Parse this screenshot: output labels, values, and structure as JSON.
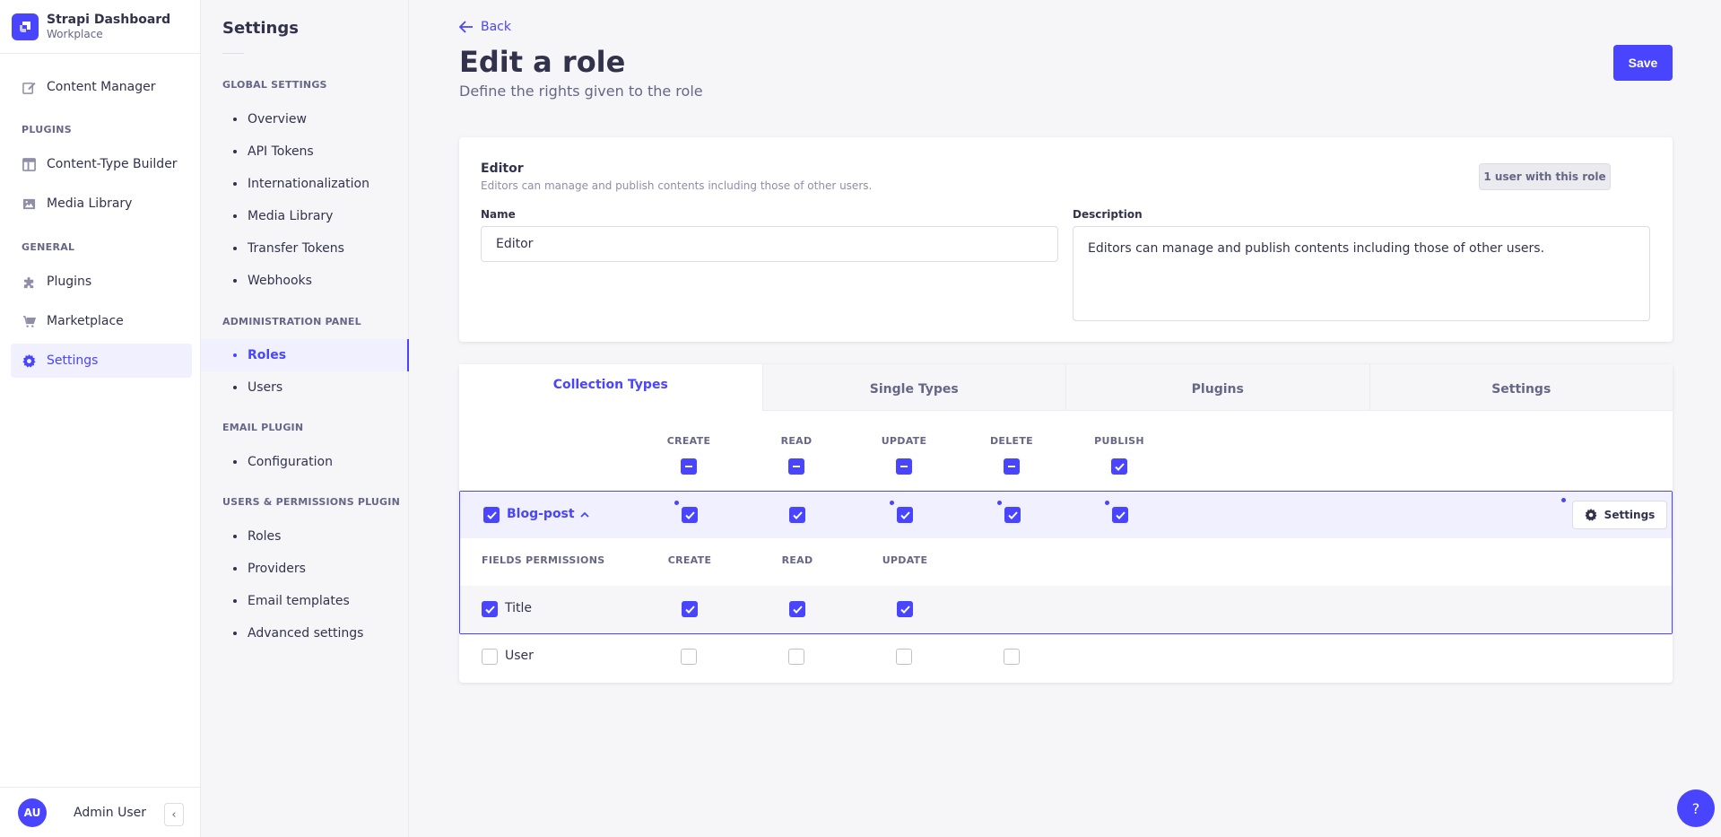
{
  "brand": {
    "title": "Strapi Dashboard",
    "subtitle": "Workplace"
  },
  "mainnav": {
    "content_manager": "Content Manager",
    "plugins_section": "PLUGINS",
    "content_type_builder": "Content-Type Builder",
    "media_library": "Media Library",
    "general_section": "GENERAL",
    "plugins": "Plugins",
    "marketplace": "Marketplace",
    "settings": "Settings"
  },
  "profile": {
    "initials": "AU",
    "name": "Admin User"
  },
  "subnav": {
    "title": "Settings",
    "global_section": "GLOBAL SETTINGS",
    "global_items": [
      "Overview",
      "API Tokens",
      "Internationalization",
      "Media Library",
      "Transfer Tokens",
      "Webhooks"
    ],
    "admin_section": "ADMINISTRATION PANEL",
    "admin_items": [
      "Roles",
      "Users"
    ],
    "email_section": "EMAIL PLUGIN",
    "email_items": [
      "Configuration"
    ],
    "up_section": "USERS & PERMISSIONS PLUGIN",
    "up_items": [
      "Roles",
      "Providers",
      "Email templates",
      "Advanced settings"
    ]
  },
  "header": {
    "back_label": "Back",
    "title": "Edit a role",
    "subtitle": "Define the rights given to the role",
    "save_label": "Save"
  },
  "role": {
    "name": "Editor",
    "description": "Editors can manage and publish contents including those of other users.",
    "users_badge": "1 user with this role",
    "name_label": "Name",
    "description_label": "Description",
    "name_value": "Editor",
    "description_value": "Editors can manage and publish contents including those of other users."
  },
  "tabs": [
    "Collection Types",
    "Single Types",
    "Plugins",
    "Settings"
  ],
  "permissions": {
    "columns": [
      "CREATE",
      "READ",
      "UPDATE",
      "DELETE",
      "PUBLISH"
    ],
    "content_type": "Blog-post",
    "row_settings_label": "Settings",
    "fields_header": "FIELDS PERMISSIONS",
    "field_columns": [
      "CREATE",
      "READ",
      "UPDATE"
    ],
    "fields": [
      {
        "name": "Title",
        "checked": true
      },
      {
        "name": "User",
        "checked": false
      }
    ]
  },
  "help_label": "?",
  "colors": {
    "accent": "#4945ff",
    "accent_light": "#f0f0ff",
    "text": "#32324d",
    "muted": "#666687"
  }
}
